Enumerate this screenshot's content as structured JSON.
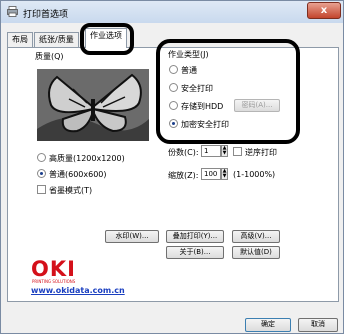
{
  "window": {
    "title": "打印首选项",
    "close_glyph": "x"
  },
  "tabs": [
    {
      "label": "布局"
    },
    {
      "label": "纸张/质量"
    },
    {
      "label": "作业选项"
    }
  ],
  "quality": {
    "group_label": "质量(Q)",
    "options": [
      {
        "label": "高质量(1200x1200)",
        "selected": false
      },
      {
        "label": "普通(600x600)",
        "selected": true
      }
    ],
    "eco_label": "省墨模式(T)"
  },
  "job_type": {
    "group_label": "作业类型(J)",
    "options": [
      {
        "label": "普通",
        "selected": false
      },
      {
        "label": "安全打印",
        "selected": false
      },
      {
        "label": "存储到HDD",
        "selected": false
      },
      {
        "label": "加密安全打印",
        "selected": true
      }
    ],
    "password_button": "密码(A)..."
  },
  "copies": {
    "label": "份数(C):",
    "value": "1",
    "collate_label": "逆序打印"
  },
  "scale": {
    "label": "缩放(Z):",
    "value": "100",
    "range": "(1-1000%)"
  },
  "buttons": {
    "watermark": "水印(W)...",
    "overlay": "叠加打印(Y)...",
    "advanced": "高级(V)...",
    "about": "关于(B)...",
    "defaults": "默认值(D)",
    "ok": "确定",
    "cancel": "取消"
  },
  "brand": {
    "logo": "OKI",
    "tagline": "PRINTING SOLUTIONS",
    "link": "www.okidata.com.cn",
    "color": "#d4101a"
  }
}
